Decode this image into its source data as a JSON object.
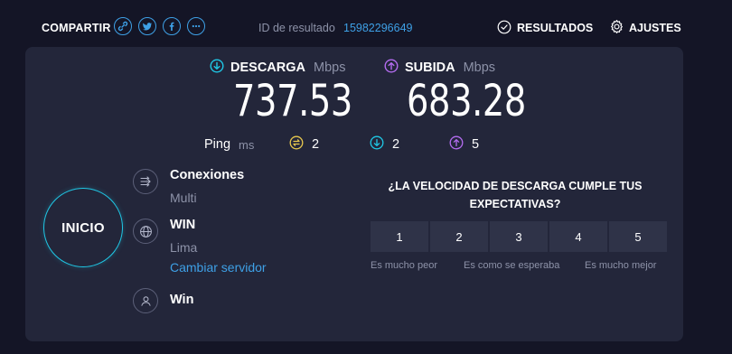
{
  "header": {
    "share_label": "COMPARTIR",
    "share_icons": [
      "link-icon",
      "twitter-icon",
      "facebook-icon",
      "more-icon"
    ],
    "result_id_label": "ID de resultado",
    "result_id_value": "15982296649",
    "results_label": "RESULTADOS",
    "settings_label": "AJUSTES"
  },
  "download": {
    "label": "DESCARGA",
    "unit": "Mbps",
    "value": "737.53",
    "color": "#1fc8e6"
  },
  "upload": {
    "label": "SUBIDA",
    "unit": "Mbps",
    "value": "683.28",
    "color": "#b46cf0"
  },
  "ping": {
    "label": "Ping",
    "unit": "ms",
    "idle": "2",
    "down": "2",
    "up": "5",
    "idle_color": "#e8c84e"
  },
  "start_button": "INICIO",
  "server": {
    "connections_title": "Conexiones",
    "connections_value": "Multi",
    "provider_name": "WIN",
    "location": "Lima",
    "change_server": "Cambiar servidor",
    "user_name": "Win"
  },
  "rating": {
    "question": "¿LA VELOCIDAD DE DESCARGA CUMPLE TUS EXPECTATIVAS?",
    "options": [
      "1",
      "2",
      "3",
      "4",
      "5"
    ],
    "caption_low": "Es mucho peor",
    "caption_mid": "Es como se esperaba",
    "caption_high": "Es mucho mejor"
  },
  "colors": {
    "accent": "#3ea0e6",
    "background": "#141526",
    "panel": "#23263a"
  }
}
